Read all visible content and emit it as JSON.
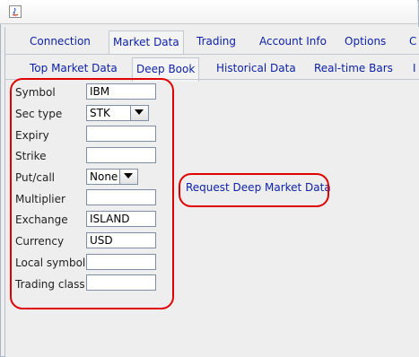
{
  "window": {
    "icon": "java-app-icon"
  },
  "main_tabs": [
    {
      "label": "Connection",
      "selected": false
    },
    {
      "label": "Market Data",
      "selected": true
    },
    {
      "label": "Trading",
      "selected": false
    },
    {
      "label": "Account Info",
      "selected": false
    },
    {
      "label": "Options",
      "selected": false
    },
    {
      "label": "C",
      "selected": false
    }
  ],
  "sub_tabs": [
    {
      "label": "Top Market Data",
      "selected": false
    },
    {
      "label": "Deep Book",
      "selected": true
    },
    {
      "label": "Historical Data",
      "selected": false
    },
    {
      "label": "Real-time Bars",
      "selected": false
    },
    {
      "label": "I",
      "selected": false
    }
  ],
  "form": {
    "symbol": {
      "label": "Symbol",
      "value": "IBM"
    },
    "sec_type": {
      "label": "Sec type",
      "value": "STK"
    },
    "expiry": {
      "label": "Expiry",
      "value": ""
    },
    "strike": {
      "label": "Strike",
      "value": ""
    },
    "put_call": {
      "label": "Put/call",
      "value": "None"
    },
    "multiplier": {
      "label": "Multiplier",
      "value": ""
    },
    "exchange": {
      "label": "Exchange",
      "value": "ISLAND"
    },
    "currency": {
      "label": "Currency",
      "value": "USD"
    },
    "local_symbol": {
      "label": "Local symbol",
      "value": ""
    },
    "trading_class": {
      "label": "Trading class",
      "value": ""
    }
  },
  "actions": {
    "request_label": "Request Deep Market Data"
  },
  "colors": {
    "tab_text": "#0b1fa6",
    "highlight": "#e00000",
    "panel": "#eeeeee"
  }
}
